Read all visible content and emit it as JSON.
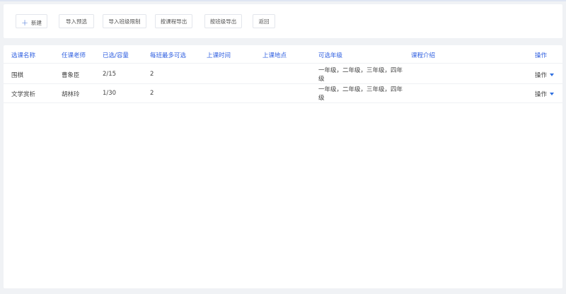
{
  "toolbar": {
    "add_label": "新建",
    "import_preselect_label": "导入预选",
    "import_class_limit_label": "导入班级限制",
    "export_by_course_label": "按课程导出",
    "export_by_class_label": "按班级导出",
    "back_label": "返回"
  },
  "table": {
    "columns": [
      "选课名称",
      "任课老师",
      "已选/容量",
      "每班最多可选",
      "上课时间",
      "上课地点",
      "可选年级",
      "课程介绍",
      "操作"
    ],
    "rows": [
      {
        "name": "围棋",
        "teacher": "曹象臣",
        "selected_capacity": "2/15",
        "max_per_class": "2",
        "time": "",
        "place": "",
        "grades": "一年级，二年级，三年级，四年级",
        "intro": "",
        "action": "操作"
      },
      {
        "name": "文学赏析",
        "teacher": "胡林玲",
        "selected_capacity": "1/30",
        "max_per_class": "2",
        "time": "",
        "place": "",
        "grades": "一年级，二年级，三年级，四年级",
        "intro": "",
        "action": "操作"
      }
    ]
  },
  "colors": {
    "accent": "#2f5fe0",
    "page_bg": "#f0f2f5",
    "card_bg": "#ffffff"
  },
  "icons": {
    "add": "plus-icon",
    "dropdown": "caret-down-icon"
  }
}
